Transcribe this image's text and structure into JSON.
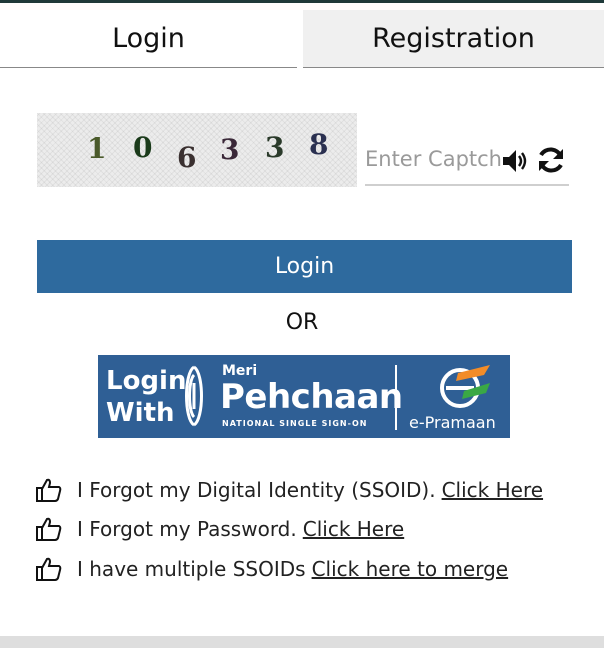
{
  "tabs": {
    "login_label": "Login",
    "registration_label": "Registration"
  },
  "captcha": {
    "digits": [
      "1",
      "0",
      "6",
      "3",
      "3",
      "8"
    ],
    "input_placeholder": "Enter Captcha",
    "input_value": "",
    "speaker_icon": "speaker-icon",
    "refresh_icon": "refresh-icon"
  },
  "login_button_label": "Login",
  "or_text": "OR",
  "meri_pehchaan": {
    "login_with_line1": "Login",
    "login_with_line2": "With",
    "meri": "Meri",
    "pehchaan": "Pehchaan",
    "tagline": "NATIONAL SINGLE SIGN-ON",
    "epramaan": "e-Pramaan",
    "brand_color": "#2f5f95"
  },
  "help_links": [
    {
      "text": "I Forgot my Digital Identity (SSOID).",
      "link": "Click Here",
      "icon": "thumbs-up-icon"
    },
    {
      "text": "I Forgot my Password.",
      "link": "Click Here",
      "icon": "thumbs-up-icon"
    },
    {
      "text": "I have multiple SSOIDs",
      "link": "Click here to merge",
      "icon": "thumbs-up-icon"
    }
  ],
  "colors": {
    "primary_button": "#2e6a9e",
    "inactive_tab": "#f0f0f0"
  }
}
